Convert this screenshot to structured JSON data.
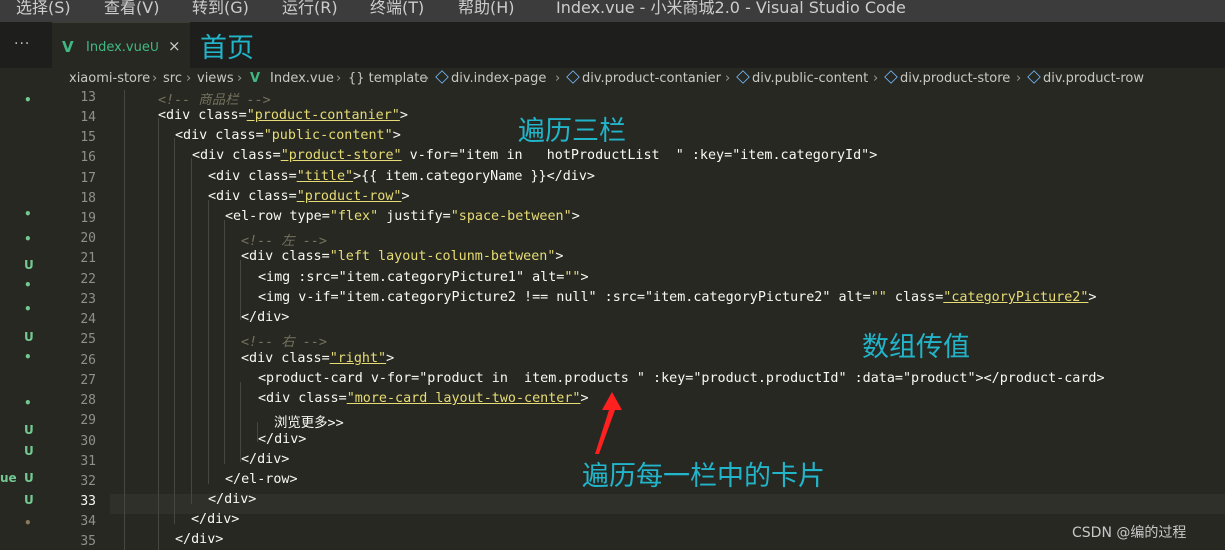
{
  "menubar": {
    "items": [
      "选择(S)",
      "查看(V)",
      "转到(G)",
      "运行(R)",
      "终端(T)",
      "帮助(H)"
    ],
    "title": "Index.vue - 小米商城2.0 - Visual Studio Code"
  },
  "tabs": {
    "more": "···",
    "active_label": "Index.vue",
    "active_status": "U",
    "close": "×"
  },
  "breadcrumb": [
    "xiaomi-store",
    "src",
    "views",
    "Index.vue",
    "{} template",
    "div.index-page",
    "div.product-contanier",
    "div.public-content",
    "div.product-store",
    "div.product-row"
  ],
  "annotations": {
    "home": "首页",
    "loop_three": "遍历三栏",
    "pass_array": "数组传值",
    "loop_cards": "遍历每一栏中的卡片"
  },
  "gutter_marks": [
    "•",
    "•",
    "•",
    "U",
    "•",
    "•",
    "U",
    "•",
    "•",
    "U",
    "U",
    "U",
    "U",
    "•"
  ],
  "gutter_extra": "ue",
  "line_numbers": [
    "13",
    "14",
    "15",
    "16",
    "17",
    "18",
    "19",
    "20",
    "21",
    "22",
    "23",
    "24",
    "25",
    "26",
    "27",
    "28",
    "29",
    "30",
    "31",
    "32",
    "33",
    "34",
    "35"
  ],
  "code": {
    "l13": "<!-- 商品栏 -->",
    "l14_tag": "<div class=",
    "l14_val": "\"product-contanier\"",
    "l14_end": ">",
    "l15_tag": "<div class=",
    "l15_val": "\"public-content\"",
    "l15_end": ">",
    "l16_tag": "<div class=",
    "l16_val": "\"product-store\"",
    "l16_vfor": " v-for=",
    "l16_q": "\"item ",
    "l16_in": "in",
    "l16_list": "   hotProductList  \"",
    "l16_key": " :key=",
    "l16_keyval": "\"item.categoryId\"",
    "l16_end": ">",
    "l17_tag": "<div class=",
    "l17_val": "\"title\"",
    "l17_rest": ">{{ item.categoryName }}</div>",
    "l18_tag": "<div class=",
    "l18_val": "\"product-row\"",
    "l18_end": ">",
    "l19_tag": "<el-row type=",
    "l19_val": "\"flex\"",
    "l19_just": " justify=",
    "l19_jval": "\"space-between\"",
    "l19_end": ">",
    "l20": "<!-- 左 -->",
    "l21_tag": "<div class=",
    "l21_val": "\"left layout-colunm-between\"",
    "l21_end": ">",
    "l22_tag": "<img :src=",
    "l22_val": "\"item.categoryPicture1\"",
    "l22_alt": " alt=",
    "l22_altv": "\"\"",
    "l22_end": ">",
    "l23_tag": "<img v-if=",
    "l23_val": "\"item.categoryPicture2 !== null\"",
    "l23_src": " :src=",
    "l23_srcv": "\"item.categoryPicture2\"",
    "l23_alt": " alt=",
    "l23_altv": "\"\"",
    "l23_cls": " class=",
    "l23_clsv": "\"categoryPicture2\"",
    "l23_end": ">",
    "l24": "</div>",
    "l25": "<!-- 右 -->",
    "l26_tag": "<div class=",
    "l26_val": "\"right\"",
    "l26_end": ">",
    "l27_tag": "<product-card v-for=",
    "l27_val": "\"product in  item.products \"",
    "l27_key": " :key=",
    "l27_keyv": "\"product.productId\"",
    "l27_data": " :data=",
    "l27_datav": "\"product\"",
    "l27_end": "></product-card>",
    "l28_tag": "<div class=",
    "l28_val": "\"more-card layout-two-center\"",
    "l28_end": ">",
    "l29": "浏览更多>>",
    "l30": "</div>",
    "l31": "</div>",
    "l32": "</el-row>",
    "l33": "</div>",
    "l34": "</div>",
    "l35": "</div>"
  },
  "watermark": "CSDN @编的过程",
  "colors": {
    "background": "#272822",
    "annotation": "#22b4c9",
    "string": "#e6db74",
    "git_untracked": "#73c991",
    "arrow": "#ff2020"
  }
}
